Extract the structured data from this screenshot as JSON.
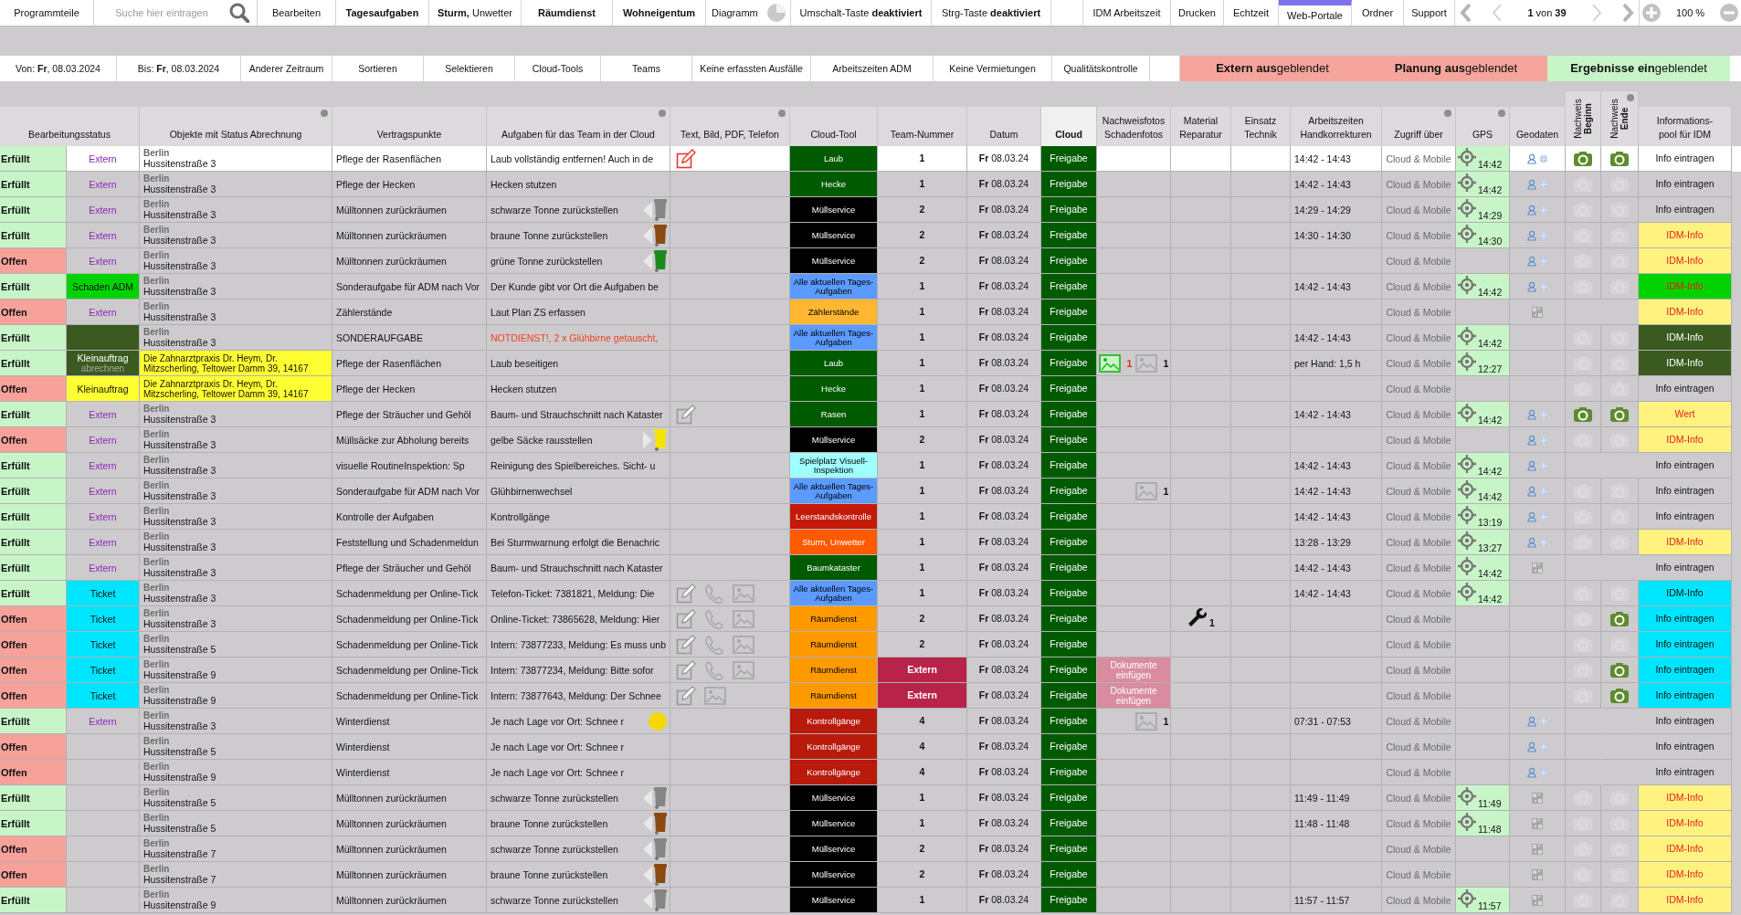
{
  "toolbar": [
    {
      "kind": "button",
      "text": "Programmteile"
    },
    {
      "kind": "search",
      "placeholder": "Suche hier eintragen"
    },
    {
      "kind": "button",
      "text": "Bearbeiten"
    },
    {
      "kind": "button",
      "text": "Tagesaufgaben",
      "bold": true
    },
    {
      "kind": "button",
      "text": "**Sturm,** Unwetter"
    },
    {
      "kind": "button",
      "text": "Räumdienst",
      "bold": true
    },
    {
      "kind": "button",
      "text": "Wohneigentum",
      "bold": true
    },
    {
      "kind": "chart",
      "text": "Diagramm"
    },
    {
      "kind": "button",
      "text": "Umschalt-Taste **deaktiviert**"
    },
    {
      "kind": "button",
      "text": "Strg-Taste **deaktiviert**"
    },
    {
      "kind": "blank"
    },
    {
      "kind": "button",
      "text": "IDM Arbeitszeit"
    },
    {
      "kind": "button",
      "text": "Drucken"
    },
    {
      "kind": "button",
      "text": "Echtzeit"
    },
    {
      "kind": "button",
      "text": "Web-Portale",
      "marked": true
    },
    {
      "kind": "button",
      "text": "Ordner"
    },
    {
      "kind": "button",
      "text": "Support"
    }
  ],
  "pager": {
    "text": "**1** von **39**"
  },
  "zoom": {
    "text": "100 %"
  },
  "filterbar": [
    {
      "kind": "button",
      "text": "Von: **Fr**, 08.03.2024"
    },
    {
      "kind": "button",
      "text": "Bis: **Fr**, 08.03.2024"
    },
    {
      "kind": "button",
      "text": "Anderer Zeitraum"
    },
    {
      "kind": "button",
      "text": "Sortieren"
    },
    {
      "kind": "button",
      "text": "Selektieren"
    },
    {
      "kind": "button",
      "text": "Cloud-Tools"
    },
    {
      "kind": "button",
      "text": "Teams"
    },
    {
      "kind": "button",
      "text": "Keine erfassten Ausfälle"
    },
    {
      "kind": "button",
      "text": "Arbeitszeiten ADM"
    },
    {
      "kind": "button",
      "text": "Keine Vermietungen"
    },
    {
      "kind": "button",
      "text": "Qualitätskontrolle"
    },
    {
      "kind": "blank"
    }
  ],
  "toggles": [
    {
      "text": "**Extern aus**geblendet",
      "on": false
    },
    {
      "text": "**Planung aus**geblendet",
      "on": false
    },
    {
      "text": "**Ergebnisse ein**geblendet",
      "on": true
    }
  ],
  "table": {
    "columns": [
      {
        "label": "Bearbeitungsstatus"
      },
      {
        "label": "Objekte mit Status Abrechnung",
        "filter": true
      },
      {
        "label": "Vertragspunkte"
      },
      {
        "label": "Aufgaben für das Team in der Cloud",
        "filter": true
      },
      {
        "label": "Text, Bild, PDF, Telefon",
        "filter": true
      },
      {
        "label": "Cloud-Tool"
      },
      {
        "label": "Team-Nummer"
      },
      {
        "label": "Datum"
      },
      {
        "label": "Cloud",
        "bold": true
      },
      {
        "label": "Nachweisfotos\nSchadenfotos"
      },
      {
        "label": "Material\nReparatur"
      },
      {
        "label": "Einsatz\nTechnik"
      },
      {
        "label": "Arbeitszeiten\nHandkorrekturen"
      },
      {
        "label": "Zugriff über",
        "filter": true
      },
      {
        "label": "GPS",
        "filter": true
      },
      {
        "label": "Geodaten"
      },
      {
        "label": "Nachweis\n**Beginn**",
        "vertical": true
      },
      {
        "label": "Nachweis\n**Ende**",
        "vertical": true,
        "filter": true
      },
      {
        "label": "Informations-\npool für IDM"
      }
    ],
    "rows": [
      {
        "selected": true,
        "done": true,
        "status": "Erfüllt",
        "tag": {
          "kind": "extern",
          "text": "Extern"
        },
        "object": {
          "kind": "place",
          "city": "Berlin",
          "street": "Hussitenstraße 3"
        },
        "contract": "Pflege der Rasenflächen",
        "task": "Laub vollständig entfernen! Auch in de",
        "media": [
          {
            "kind": "edit",
            "color": "#e8372c"
          }
        ],
        "tool": {
          "text": "Laub",
          "color": "#005a00"
        },
        "team": "1",
        "day": "Fr",
        "date": "08.03.24",
        "release": "Freigabe",
        "time": "14:42 - 14:43",
        "access": "Cloud & Mobile",
        "gps": "14:42",
        "geo": {
          "kind": "person"
        },
        "begin": {
          "kind": "camera",
          "on": true
        },
        "end": {
          "kind": "camera",
          "on": true
        },
        "info": {
          "kind": "plain",
          "text": "Info eintragen"
        }
      },
      {
        "selected": false,
        "done": true,
        "status": "Erfüllt",
        "tag": {
          "kind": "extern",
          "text": "Extern"
        },
        "object": {
          "kind": "place",
          "city": "Berlin",
          "street": "Hussitenstraße 3"
        },
        "contract": "Pflege der Hecken",
        "task": "Hecken stutzen",
        "tool": {
          "text": "Hecke",
          "color": "#005a00"
        },
        "team": "1",
        "day": "Fr",
        "date": "08.03.24",
        "release": "Freigabe",
        "time": "14:42 - 14:43",
        "access": "Cloud & Mobile",
        "gps": "14:42",
        "geo": {
          "kind": "person"
        },
        "begin": {
          "kind": "camera",
          "on": false
        },
        "end": {
          "kind": "camera",
          "on": false
        },
        "info": {
          "kind": "plain",
          "text": "Info eintragen"
        }
      },
      {
        "selected": false,
        "done": true,
        "status": "Erfüllt",
        "tag": {
          "kind": "extern",
          "text": "Extern"
        },
        "object": {
          "kind": "place",
          "city": "Berlin",
          "street": "Hussitenstraße 3"
        },
        "contract": "Mülltonnen zurückräumen",
        "task": "schwarze Tonne zurückstellen",
        "marker": {
          "kind": "bin",
          "color": "#858585"
        },
        "tool": {
          "text": "Müllservice",
          "color": "#000000"
        },
        "team": "2",
        "day": "Fr",
        "date": "08.03.24",
        "release": "Freigabe",
        "time": "14:29 - 14:29",
        "access": "Cloud & Mobile",
        "gps": "14:29",
        "geo": {
          "kind": "person"
        },
        "begin": {
          "kind": "camera",
          "on": false
        },
        "end": {
          "kind": "camera",
          "on": false
        },
        "info": {
          "kind": "plain",
          "text": "Info eintragen"
        }
      },
      {
        "selected": false,
        "done": true,
        "status": "Erfüllt",
        "tag": {
          "kind": "extern",
          "text": "Extern"
        },
        "object": {
          "kind": "place",
          "city": "Berlin",
          "street": "Hussitenstraße 3"
        },
        "contract": "Mülltonnen zurückräumen",
        "task": "braune Tonne zurückstellen",
        "marker": {
          "kind": "bin",
          "color": "#8a4a12"
        },
        "tool": {
          "text": "Müllservice",
          "color": "#000000"
        },
        "team": "2",
        "day": "Fr",
        "date": "08.03.24",
        "release": "Freigabe",
        "time": "14:30 - 14:30",
        "access": "Cloud & Mobile",
        "gps": "14:30",
        "geo": {
          "kind": "person"
        },
        "begin": {
          "kind": "camera",
          "on": false
        },
        "end": {
          "kind": "camera",
          "on": false
        },
        "info": {
          "kind": "note",
          "text": "IDM-Info"
        }
      },
      {
        "selected": false,
        "done": false,
        "status": "Offen",
        "tag": {
          "kind": "extern",
          "text": "Extern"
        },
        "object": {
          "kind": "place",
          "city": "Berlin",
          "street": "Hussitenstraße 3"
        },
        "contract": "Mülltonnen zurückräumen",
        "task": "grüne Tonne zurückstellen",
        "marker": {
          "kind": "bin",
          "color": "#1e8a1e"
        },
        "tool": {
          "text": "Müllservice",
          "color": "#000000"
        },
        "team": "2",
        "day": "Fr",
        "date": "08.03.24",
        "release": "Freigabe",
        "access": "Cloud & Mobile",
        "geo": {
          "kind": "person"
        },
        "begin": {
          "kind": "camera",
          "on": false
        },
        "end": {
          "kind": "camera",
          "on": false
        },
        "info": {
          "kind": "note",
          "text": "IDM-Info"
        }
      },
      {
        "selected": false,
        "done": true,
        "status": "Erfüllt",
        "tag": {
          "kind": "schaden",
          "text": "Schaden ADM"
        },
        "object": {
          "kind": "place",
          "city": "Berlin",
          "street": "Hussitenstraße 3"
        },
        "contract": "Sonderaufgabe für ADM nach Vor",
        "task": "Der Kunde gibt vor Ort die Aufgaben be",
        "tool": {
          "text": "Alle aktuellen Tages-Aufgaben",
          "color": "#5b9bff"
        },
        "team": "1",
        "day": "Fr",
        "date": "08.03.24",
        "release": "Freigabe",
        "time": "14:42 - 14:43",
        "access": "Cloud & Mobile",
        "gps": "14:42",
        "geo": {
          "kind": "person"
        },
        "begin": {
          "kind": "camera",
          "on": false
        },
        "end": {
          "kind": "camera",
          "on": false
        },
        "info": {
          "kind": "bright",
          "text": "IDM-Info"
        }
      },
      {
        "selected": false,
        "done": false,
        "status": "Offen",
        "tag": {
          "kind": "extern",
          "text": "Extern"
        },
        "object": {
          "kind": "place",
          "city": "Berlin",
          "street": "Hussitenstraße 3"
        },
        "contract": "Zählerstände",
        "task": "Laut Plan ZS erfassen",
        "tool": {
          "text": "Zählerstände",
          "color": "#ffb733"
        },
        "team": "1",
        "day": "Fr",
        "date": "08.03.24",
        "release": "Freigabe",
        "access": "Cloud & Mobile",
        "geo": {
          "kind": "code"
        },
        "info": {
          "kind": "note",
          "text": "IDM-Info"
        }
      },
      {
        "selected": false,
        "done": true,
        "status": "Erfüllt",
        "tag": {
          "kind": "dark"
        },
        "object": {
          "kind": "place",
          "city": "Berlin",
          "street": "Hussitenstraße 3"
        },
        "contract": "SONDERAUFGABE",
        "task": "NOTDIENST!, 2 x Glühbirne getauscht,",
        "alert": true,
        "tool": {
          "text": "Alle aktuellen Tages-Aufgaben",
          "color": "#5b9bff"
        },
        "team": "1",
        "day": "Fr",
        "date": "08.03.24",
        "release": "Freigabe",
        "time": "14:42 - 14:43",
        "access": "Cloud & Mobile",
        "gps": "14:42",
        "begin": {
          "kind": "camera",
          "on": false
        },
        "end": {
          "kind": "camera",
          "on": false
        },
        "info": {
          "kind": "dark",
          "text": "IDM-Info"
        }
      },
      {
        "selected": false,
        "done": true,
        "status": "Erfüllt",
        "tag": {
          "kind": "settle",
          "text": "Kleinauftrag",
          "note": "abrechnen"
        },
        "object": {
          "kind": "address",
          "text": "Die Zahnarztpraxis Dr. Heym, Dr. Mitzscherling, Teltower Damm 39, 14167"
        },
        "contract": "Pflege der Rasenflächen",
        "task": "Laub beseitigen",
        "tool": {
          "text": "Laub",
          "color": "#005a00"
        },
        "team": "1",
        "day": "Fr",
        "date": "08.03.24",
        "release": "Freigabe",
        "proof": "1",
        "damage": "1",
        "time": "per Hand: 1,5 h",
        "access": "Cloud & Mobile",
        "gps": "12:27",
        "begin": {
          "kind": "camera",
          "on": false
        },
        "end": {
          "kind": "camera",
          "on": false
        },
        "info": {
          "kind": "dark",
          "text": "IDM-Info"
        }
      },
      {
        "selected": false,
        "done": false,
        "status": "Offen",
        "tag": {
          "kind": "small-job",
          "text": "Kleinauftrag"
        },
        "object": {
          "kind": "address",
          "text": "Die Zahnarztpraxis Dr. Heym, Dr. Mitzscherling, Teltower Damm 39, 14167"
        },
        "contract": "Pflege der Hecken",
        "task": "Hecken stutzen",
        "tool": {
          "text": "Hecke",
          "color": "#005a00"
        },
        "team": "1",
        "day": "Fr",
        "date": "08.03.24",
        "release": "Freigabe",
        "access": "Cloud & Mobile",
        "begin": {
          "kind": "camera",
          "on": false
        },
        "end": {
          "kind": "camera",
          "on": false
        },
        "info": {
          "kind": "plain",
          "text": "Info eintragen"
        }
      },
      {
        "selected": false,
        "done": true,
        "status": "Erfüllt",
        "tag": {
          "kind": "extern",
          "text": "Extern"
        },
        "object": {
          "kind": "place",
          "city": "Berlin",
          "street": "Hussitenstraße 3"
        },
        "contract": "Pflege der Sträucher und Gehöl",
        "task": "Baum- und Strauchschnitt nach Kataster",
        "media": [
          {
            "kind": "edit",
            "color": "#9a9a9a"
          }
        ],
        "tool": {
          "text": "Rasen",
          "color": "#005a00"
        },
        "team": "1",
        "day": "Fr",
        "date": "08.03.24",
        "release": "Freigabe",
        "time": "14:42 - 14:43",
        "access": "Cloud & Mobile",
        "gps": "14:42",
        "geo": {
          "kind": "person"
        },
        "begin": {
          "kind": "camera",
          "on": true
        },
        "end": {
          "kind": "camera",
          "on": true
        },
        "info": {
          "kind": "note",
          "text": "Wert"
        }
      },
      {
        "selected": false,
        "done": false,
        "status": "Offen",
        "tag": {
          "kind": "extern",
          "text": "Extern"
        },
        "object": {
          "kind": "place",
          "city": "Berlin",
          "street": "Hussitenstraße 3"
        },
        "contract": "Müllsäcke zur Abholung bereits",
        "task": "gelbe Säcke rausstellen",
        "marker": {
          "kind": "bag",
          "color": "#f5e400"
        },
        "tool": {
          "text": "Müllservice",
          "color": "#000000"
        },
        "team": "2",
        "day": "Fr",
        "date": "08.03.24",
        "release": "Freigabe",
        "access": "Cloud & Mobile",
        "geo": {
          "kind": "person"
        },
        "begin": {
          "kind": "camera",
          "on": false
        },
        "end": {
          "kind": "camera",
          "on": false
        },
        "info": {
          "kind": "note",
          "text": "IDM-Info"
        }
      },
      {
        "selected": false,
        "done": true,
        "status": "Erfüllt",
        "tag": {
          "kind": "extern",
          "text": "Extern"
        },
        "object": {
          "kind": "place",
          "city": "Berlin",
          "street": "Hussitenstraße 3"
        },
        "contract": "visuelle RoutineInspektion: Sp",
        "task": "Reinigung des Spielbereiches. Sicht- u",
        "tool": {
          "text": "Spielplatz Visuell-Inspektion",
          "color": "#a0ffff"
        },
        "team": "1",
        "day": "Fr",
        "date": "08.03.24",
        "release": "Freigabe",
        "time": "14:42 - 14:43",
        "access": "Cloud & Mobile",
        "gps": "14:42",
        "geo": {
          "kind": "person"
        },
        "info": {
          "kind": "plain",
          "text": "Info eintragen"
        }
      },
      {
        "selected": false,
        "done": true,
        "status": "Erfüllt",
        "tag": {
          "kind": "extern",
          "text": "Extern"
        },
        "object": {
          "kind": "place",
          "city": "Berlin",
          "street": "Hussitenstraße 3"
        },
        "contract": "Sonderaufgabe für ADM nach Vor",
        "task": "Glühbirnenwechsel",
        "tool": {
          "text": "Alle aktuellen Tages-Aufgaben",
          "color": "#5b9bff"
        },
        "team": "1",
        "day": "Fr",
        "date": "08.03.24",
        "release": "Freigabe",
        "damage": "1",
        "time": "14:42 - 14:43",
        "access": "Cloud & Mobile",
        "gps": "14:42",
        "geo": {
          "kind": "person"
        },
        "begin": {
          "kind": "camera",
          "on": false
        },
        "end": {
          "kind": "camera",
          "on": false
        },
        "info": {
          "kind": "plain",
          "text": "Info eintragen"
        }
      },
      {
        "selected": false,
        "done": true,
        "status": "Erfüllt",
        "tag": {
          "kind": "extern",
          "text": "Extern"
        },
        "object": {
          "kind": "place",
          "city": "Berlin",
          "street": "Hussitenstraße 3"
        },
        "contract": "Kontrolle der Aufgaben",
        "task": "Kontrollgänge",
        "tool": {
          "text": "Leerstandskontrolle",
          "color": "#c41a0a"
        },
        "team": "1",
        "day": "Fr",
        "date": "08.03.24",
        "release": "Freigabe",
        "time": "14:42 - 14:43",
        "access": "Cloud & Mobile",
        "gps": "13:19",
        "geo": {
          "kind": "person"
        },
        "begin": {
          "kind": "camera",
          "on": false
        },
        "end": {
          "kind": "camera",
          "on": false
        },
        "info": {
          "kind": "plain",
          "text": "Info eintragen"
        }
      },
      {
        "selected": false,
        "done": true,
        "status": "Erfüllt",
        "tag": {
          "kind": "extern",
          "text": "Extern"
        },
        "object": {
          "kind": "place",
          "city": "Berlin",
          "street": "Hussitenstraße 3"
        },
        "contract": "Feststellung und Schadenmeldun",
        "task": "Bei Sturmwarnung erfolgt die Benachric",
        "tool": {
          "text": "Sturm, Unwetter",
          "color": "#ff5a00"
        },
        "team": "1",
        "day": "Fr",
        "date": "08.03.24",
        "release": "Freigabe",
        "time": "13:28 - 13:29",
        "access": "Cloud & Mobile",
        "gps": "13:27",
        "geo": {
          "kind": "person"
        },
        "begin": {
          "kind": "camera",
          "on": false
        },
        "end": {
          "kind": "camera",
          "on": false
        },
        "info": {
          "kind": "note",
          "text": "IDM-Info"
        }
      },
      {
        "selected": false,
        "done": true,
        "status": "Erfüllt",
        "tag": {
          "kind": "extern",
          "text": "Extern"
        },
        "object": {
          "kind": "place",
          "city": "Berlin",
          "street": "Hussitenstraße 3"
        },
        "contract": "Pflege der Sträucher und Gehöl",
        "task": "Baum- und Strauchschnitt nach Kataster",
        "tool": {
          "text": "Baumkataster",
          "color": "#005a00"
        },
        "team": "1",
        "day": "Fr",
        "date": "08.03.24",
        "release": "Freigabe",
        "time": "14:42 - 14:43",
        "access": "Cloud & Mobile",
        "gps": "14:42",
        "geo": {
          "kind": "code"
        },
        "info": {
          "kind": "plain",
          "text": "Info eintragen"
        }
      },
      {
        "selected": false,
        "done": true,
        "status": "Erfüllt",
        "tag": {
          "kind": "ticket",
          "text": "Ticket"
        },
        "object": {
          "kind": "place",
          "city": "Berlin",
          "street": "Hussitenstraße 3"
        },
        "contract": "Schadenmeldung per Online-Tick",
        "task": "Telefon-Ticket: 7381821, Meldung: Die",
        "media": [
          {
            "kind": "edit",
            "color": "#9a9a9a"
          },
          {
            "kind": "phone"
          },
          {
            "kind": "image"
          }
        ],
        "tool": {
          "text": "Alle aktuellen Tages-Aufgaben",
          "color": "#5b9bff"
        },
        "team": "1",
        "day": "Fr",
        "date": "08.03.24",
        "release": "Freigabe",
        "time": "14:42 - 14:43",
        "access": "Cloud & Mobile",
        "gps": "14:42",
        "begin": {
          "kind": "camera",
          "on": false
        },
        "end": {
          "kind": "camera",
          "on": false
        },
        "info": {
          "kind": "cyan",
          "text": "IDM-Info"
        }
      },
      {
        "selected": false,
        "done": false,
        "status": "Offen",
        "tag": {
          "kind": "ticket",
          "text": "Ticket"
        },
        "object": {
          "kind": "place",
          "city": "Berlin",
          "street": "Hussitenstraße 3"
        },
        "contract": "Schadenmeldung per Online-Tick",
        "task": "Online-Ticket: 73865628, Meldung: Hier",
        "media": [
          {
            "kind": "edit",
            "color": "#9a9a9a"
          },
          {
            "kind": "phone"
          },
          {
            "kind": "image"
          }
        ],
        "tool": {
          "text": "Räumdienst",
          "color": "#ff9900"
        },
        "team": "2",
        "day": "Fr",
        "date": "08.03.24",
        "release": "Freigabe",
        "repair": "1",
        "access": "Cloud & Mobile",
        "begin": {
          "kind": "camera",
          "on": false
        },
        "end": {
          "kind": "camera",
          "on": true
        },
        "info": {
          "kind": "cyan",
          "text": "Info eintragen"
        }
      },
      {
        "selected": false,
        "done": false,
        "status": "Offen",
        "tag": {
          "kind": "ticket",
          "text": "Ticket"
        },
        "object": {
          "kind": "place",
          "city": "Berlin",
          "street": "Hussitenstraße 5"
        },
        "contract": "Schadenmeldung per Online-Tick",
        "task": "Intern: 73877233, Meldung: Es muss unb",
        "media": [
          {
            "kind": "edit",
            "color": "#9a9a9a"
          },
          {
            "kind": "phone"
          },
          {
            "kind": "image"
          }
        ],
        "tool": {
          "text": "Räumdienst",
          "color": "#ff9900"
        },
        "team": "2",
        "day": "Fr",
        "date": "08.03.24",
        "release": "Freigabe",
        "access": "Cloud & Mobile",
        "begin": {
          "kind": "camera",
          "on": false
        },
        "end": {
          "kind": "camera",
          "on": false
        },
        "info": {
          "kind": "cyan",
          "text": "Info eintragen"
        }
      },
      {
        "selected": false,
        "done": false,
        "status": "Offen",
        "tag": {
          "kind": "ticket",
          "text": "Ticket"
        },
        "object": {
          "kind": "place",
          "city": "Berlin",
          "street": "Hussitenstraße 9"
        },
        "contract": "Schadenmeldung per Online-Tick",
        "task": "Intern: 73877234, Meldung: Bitte sofor",
        "media": [
          {
            "kind": "edit",
            "color": "#9a9a9a"
          },
          {
            "kind": "phone"
          },
          {
            "kind": "image"
          }
        ],
        "tool": {
          "text": "Räumdienst",
          "color": "#ff9900"
        },
        "team": "Extern",
        "team_flag": true,
        "day": "Fr",
        "date": "08.03.24",
        "release": "Freigabe",
        "docs": "Dokumente einfügen",
        "access": "Cloud & Mobile",
        "begin": {
          "kind": "camera",
          "on": false
        },
        "end": {
          "kind": "camera",
          "on": true
        },
        "info": {
          "kind": "cyan",
          "text": "Info eintragen"
        }
      },
      {
        "selected": false,
        "done": false,
        "status": "Offen",
        "tag": {
          "kind": "ticket",
          "text": "Ticket"
        },
        "object": {
          "kind": "place",
          "city": "Berlin",
          "street": "Hussitenstraße 9"
        },
        "contract": "Schadenmeldung per Online-Tick",
        "task": "Intern: 73877643, Meldung: Der Schnee",
        "media": [
          {
            "kind": "edit",
            "color": "#9a9a9a"
          },
          {
            "kind": "image"
          }
        ],
        "tool": {
          "text": "Räumdienst",
          "color": "#ff9900"
        },
        "team": "Extern",
        "team_flag": true,
        "day": "Fr",
        "date": "08.03.24",
        "release": "Freigabe",
        "docs": "Dokumente einfügen",
        "access": "Cloud & Mobile",
        "begin": {
          "kind": "camera",
          "on": false
        },
        "end": {
          "kind": "camera",
          "on": true
        },
        "info": {
          "kind": "cyan",
          "text": "Info eintragen"
        }
      },
      {
        "selected": false,
        "done": true,
        "status": "Erfüllt",
        "tag": {
          "kind": "extern",
          "text": "Extern"
        },
        "object": {
          "kind": "place",
          "city": "Berlin",
          "street": "Hussitenstraße 3"
        },
        "contract": "Winterdienst",
        "task": "Je nach Lage vor Ort: Schnee r",
        "marker": {
          "kind": "dot",
          "color": "#f5d800"
        },
        "tool": {
          "text": "Kontrollgänge",
          "color": "#b81a0c"
        },
        "team": "4",
        "day": "Fr",
        "date": "08.03.24",
        "release": "Freigabe",
        "damage": "1",
        "time": "07:31 - 07:53",
        "access": "Cloud & Mobile",
        "geo": {
          "kind": "person"
        },
        "info": {
          "kind": "plain",
          "text": "Info eintragen"
        }
      },
      {
        "selected": false,
        "done": false,
        "status": "Offen",
        "object": {
          "kind": "place",
          "city": "Berlin",
          "street": "Hussitenstraße 5"
        },
        "contract": "Winterdienst",
        "task": "Je nach Lage vor Ort: Schnee r",
        "tool": {
          "text": "Kontrollgänge",
          "color": "#b81a0c"
        },
        "team": "4",
        "day": "Fr",
        "date": "08.03.24",
        "release": "Freigabe",
        "access": "Cloud & Mobile",
        "geo": {
          "kind": "person"
        },
        "info": {
          "kind": "plain",
          "text": "Info eintragen"
        }
      },
      {
        "selected": false,
        "done": false,
        "status": "Offen",
        "object": {
          "kind": "place",
          "city": "Berlin",
          "street": "Hussitenstraße 9"
        },
        "contract": "Winterdienst",
        "task": "Je nach Lage vor Ort: Schnee r",
        "tool": {
          "text": "Kontrollgänge",
          "color": "#b81a0c"
        },
        "team": "4",
        "day": "Fr",
        "date": "08.03.24",
        "release": "Freigabe",
        "access": "Cloud & Mobile",
        "geo": {
          "kind": "person"
        },
        "info": {
          "kind": "plain",
          "text": "Info eintragen"
        }
      },
      {
        "selected": false,
        "done": true,
        "status": "Erfüllt",
        "object": {
          "kind": "place",
          "city": "Berlin",
          "street": "Hussitenstraße 5"
        },
        "contract": "Mülltonnen zurückräumen",
        "task": "schwarze Tonne zurückstellen",
        "marker": {
          "kind": "bin",
          "color": "#858585"
        },
        "tool": {
          "text": "Müllservice",
          "color": "#000000"
        },
        "team": "1",
        "day": "Fr",
        "date": "08.03.24",
        "release": "Freigabe",
        "time": "11:49 - 11:49",
        "access": "Cloud & Mobile",
        "gps": "11:49",
        "geo": {
          "kind": "code"
        },
        "begin": {
          "kind": "camera",
          "on": false
        },
        "end": {
          "kind": "camera",
          "on": false
        },
        "info": {
          "kind": "note",
          "text": "IDM-Info"
        }
      },
      {
        "selected": false,
        "done": true,
        "status": "Erfüllt",
        "object": {
          "kind": "place",
          "city": "Berlin",
          "street": "Hussitenstraße 5"
        },
        "contract": "Mülltonnen zurückräumen",
        "task": "braune Tonne zurückstellen",
        "marker": {
          "kind": "bin",
          "color": "#8a4a12"
        },
        "tool": {
          "text": "Müllservice",
          "color": "#000000"
        },
        "team": "1",
        "day": "Fr",
        "date": "08.03.24",
        "release": "Freigabe",
        "time": "11:48 - 11:48",
        "access": "Cloud & Mobile",
        "gps": "11:48",
        "geo": {
          "kind": "code"
        },
        "begin": {
          "kind": "camera",
          "on": false
        },
        "end": {
          "kind": "camera",
          "on": false
        },
        "info": {
          "kind": "note",
          "text": "IDM-Info"
        }
      },
      {
        "selected": false,
        "done": false,
        "status": "Offen",
        "object": {
          "kind": "place",
          "city": "Berlin",
          "street": "Hussitenstraße 7"
        },
        "contract": "Mülltonnen zurückräumen",
        "task": "schwarze Tonne zurückstellen",
        "marker": {
          "kind": "bin",
          "color": "#858585"
        },
        "tool": {
          "text": "Müllservice",
          "color": "#000000"
        },
        "team": "2",
        "day": "Fr",
        "date": "08.03.24",
        "release": "Freigabe",
        "access": "Cloud & Mobile",
        "geo": {
          "kind": "code"
        },
        "begin": {
          "kind": "camera",
          "on": false
        },
        "end": {
          "kind": "camera",
          "on": false
        },
        "info": {
          "kind": "note",
          "text": "IDM-Info"
        }
      },
      {
        "selected": false,
        "done": false,
        "status": "Offen",
        "object": {
          "kind": "place",
          "city": "Berlin",
          "street": "Hussitenstraße 7"
        },
        "contract": "Mülltonnen zurückräumen",
        "task": "braune Tonne zurückstellen",
        "marker": {
          "kind": "bin",
          "color": "#8a4a12"
        },
        "tool": {
          "text": "Müllservice",
          "color": "#000000"
        },
        "team": "2",
        "day": "Fr",
        "date": "08.03.24",
        "release": "Freigabe",
        "access": "Cloud & Mobile",
        "geo": {
          "kind": "code"
        },
        "begin": {
          "kind": "camera",
          "on": false
        },
        "end": {
          "kind": "camera",
          "on": false
        },
        "info": {
          "kind": "note",
          "text": "IDM-Info"
        }
      },
      {
        "selected": false,
        "done": true,
        "status": "Erfüllt",
        "object": {
          "kind": "place",
          "city": "Berlin",
          "street": "Hussitenstraße 9"
        },
        "contract": "Mülltonnen zurückräumen",
        "task": "schwarze Tonne zurückstellen",
        "marker": {
          "kind": "bin",
          "color": "#858585"
        },
        "tool": {
          "text": "Müllservice",
          "color": "#000000"
        },
        "team": "1",
        "day": "Fr",
        "date": "08.03.24",
        "release": "Freigabe",
        "time": "11:57 - 11:57",
        "access": "Cloud & Mobile",
        "gps": "11:57",
        "geo": {
          "kind": "code"
        },
        "begin": {
          "kind": "camera",
          "on": false
        },
        "end": {
          "kind": "camera",
          "on": false
        },
        "info": {
          "kind": "note",
          "text": "IDM-Info"
        }
      }
    ]
  }
}
